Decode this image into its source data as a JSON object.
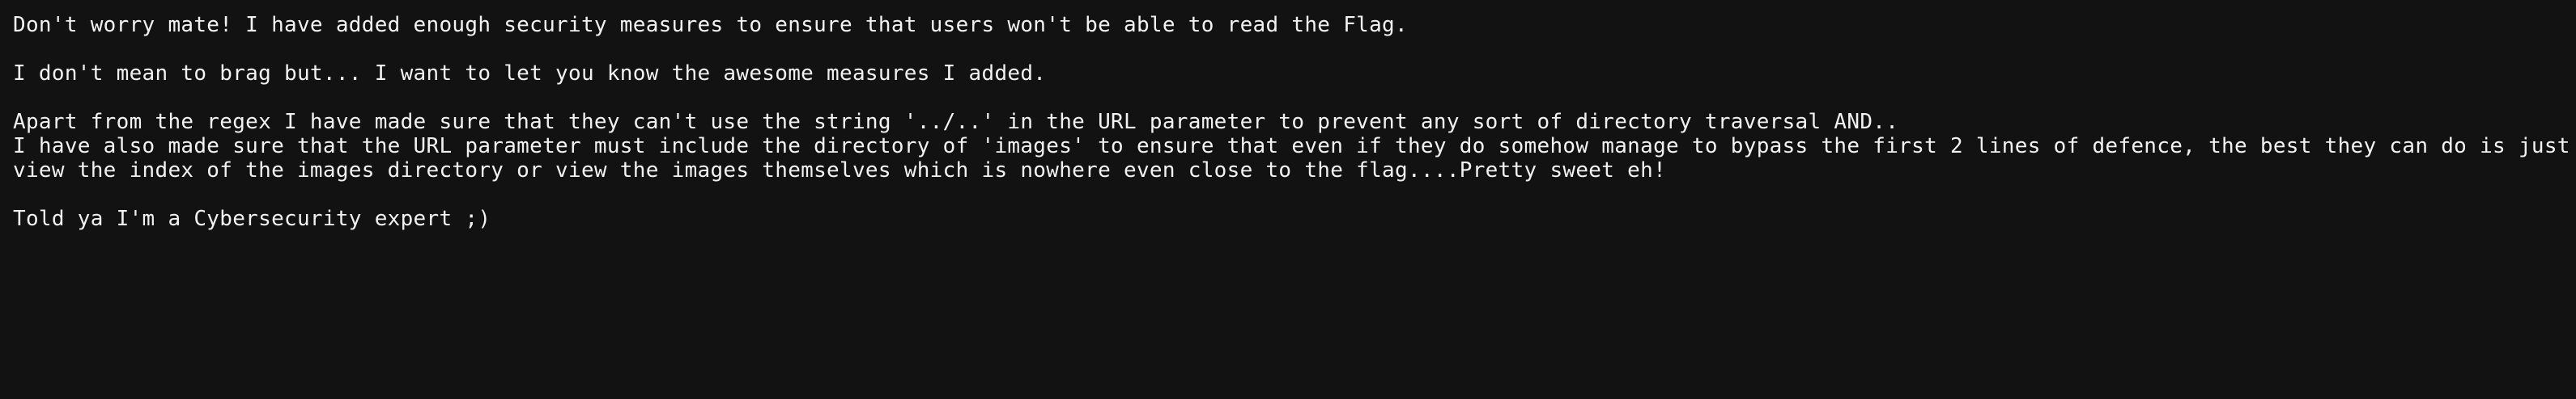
{
  "message": {
    "p1": "Don't worry mate! I have added enough security measures to ensure that users won't be able to read the Flag.",
    "p2": "I don't mean to brag but... I want to let you know the awesome measures I added.",
    "p3_line1": "Apart from the regex I have made sure that they can't use the string '../..' in the URL parameter to prevent any sort of directory traversal AND..",
    "p3_line2": "I have also made sure that the URL parameter must include the directory of 'images' to ensure that even if they do somehow manage to bypass the first 2 lines of defence, the best they can do is just",
    "p3_line3": "view the index of the images directory or view the images themselves which is nowhere even close to the flag....Pretty sweet eh!",
    "p4": "Told ya I'm a Cybersecurity expert ;)"
  },
  "colors": {
    "background": "#121212",
    "text": "#f2f2f2"
  }
}
